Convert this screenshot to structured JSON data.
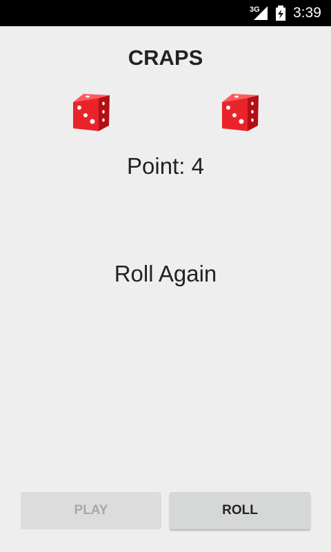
{
  "status_bar": {
    "network": "3G",
    "time": "3:39"
  },
  "title": "CRAPS",
  "dice": [
    {
      "name": "left",
      "icon": "die-icon"
    },
    {
      "name": "right",
      "icon": "die-icon"
    }
  ],
  "point_text": "Point: 4",
  "message": "Roll Again",
  "buttons": {
    "play_label": "PLAY",
    "roll_label": "ROLL"
  },
  "colors": {
    "die_red": "#e8242a",
    "status_bar": "#000000",
    "background": "#eeeeee"
  }
}
